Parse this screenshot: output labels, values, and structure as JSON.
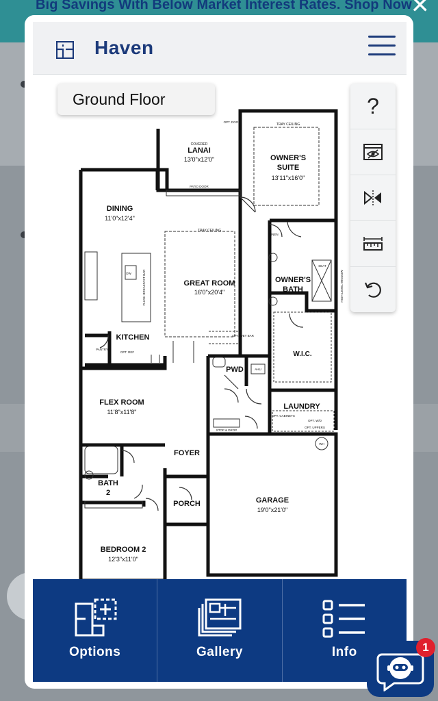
{
  "promo": {
    "text": "Big Savings With Below Market Interest Rates. Shop Now",
    "close": "✕"
  },
  "header": {
    "brand": "Haven"
  },
  "floor": {
    "label": "Ground Floor"
  },
  "rooms": {
    "lanai": {
      "pre": "COVERED",
      "name": "LANAI",
      "dims": "13'0\"x12'0\""
    },
    "owners_suite": {
      "name1": "OWNER'S",
      "name2": "SUITE",
      "dims": "13'11\"x16'0\"",
      "note": "TRAY CEILING"
    },
    "dining": {
      "name": "DINING",
      "dims": "11'0\"x12'4\""
    },
    "great_room": {
      "name": "GREAT ROOM",
      "dims": "16'0\"x20'4\"",
      "note": "TRAY CEILING"
    },
    "owners_bath": {
      "name1": "OWNER'S",
      "name2": "BATH"
    },
    "kitchen": {
      "name": "KITCHEN"
    },
    "wic": {
      "name": "W.I.C."
    },
    "pwd": {
      "name": "PWD"
    },
    "laundry": {
      "name": "LAUNDRY"
    },
    "flex": {
      "name": "FLEX ROOM",
      "dims": "11'8\"x11'8\""
    },
    "foyer": {
      "name": "FOYER"
    },
    "garage": {
      "name": "GARAGE",
      "dims": "19'0\"x21'0\""
    },
    "bath2": {
      "name1": "BATH",
      "name2": "2"
    },
    "porch": {
      "name": "PORCH"
    },
    "bedroom2": {
      "name": "BEDROOM 2",
      "dims": "12'3\"x11'0\""
    }
  },
  "small_labels": {
    "opt_door": "OPT. DOOR",
    "patio_door": "PATIO DOOR",
    "linen": "LINEN",
    "seat": "SEAT",
    "high_window": "HIGH LEVEL WINDOW",
    "pantry": "PANTRY",
    "opt_ref": "OPT. REF",
    "opt_wet_bar": "OPT. WET BAR",
    "dw": "DW",
    "flush_bar": "FLUSH BREAKFAST BAR",
    "ahu": "AHU",
    "opt_cabinets": "OPT. CABINETS",
    "opt_wd": "OPT. W/D",
    "opt_uppers": "OPT. UPPERS",
    "stop_drop": "STOP & DROP",
    "wh": "WH"
  },
  "tools": [
    {
      "icon": "help-icon",
      "glyph": "?"
    },
    {
      "icon": "eye-hidden-icon"
    },
    {
      "icon": "mirror-flip-icon"
    },
    {
      "icon": "measure-icon"
    },
    {
      "icon": "undo-icon"
    }
  ],
  "bottom": {
    "options": "Options",
    "gallery": "Gallery",
    "info": "Info"
  },
  "chat": {
    "badge": "1"
  },
  "colors": {
    "navy": "#0d3a82",
    "promo": "#2f8f94",
    "badge": "#e0202d"
  }
}
